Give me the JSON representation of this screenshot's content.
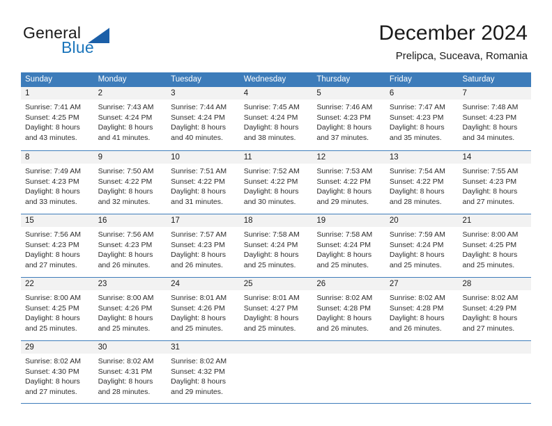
{
  "brand": {
    "name_part1": "General",
    "name_part2": "Blue"
  },
  "header": {
    "month_title": "December 2024",
    "location": "Prelipca, Suceava, Romania"
  },
  "colors": {
    "header_blue": "#3d7cba",
    "brand_blue": "#1b75bb",
    "day_band_gray": "#f2f2f2"
  },
  "weekdays": [
    "Sunday",
    "Monday",
    "Tuesday",
    "Wednesday",
    "Thursday",
    "Friday",
    "Saturday"
  ],
  "weeks": [
    [
      {
        "day": "1",
        "sunrise": "Sunrise: 7:41 AM",
        "sunset": "Sunset: 4:25 PM",
        "daylight1": "Daylight: 8 hours",
        "daylight2": "and 43 minutes."
      },
      {
        "day": "2",
        "sunrise": "Sunrise: 7:43 AM",
        "sunset": "Sunset: 4:24 PM",
        "daylight1": "Daylight: 8 hours",
        "daylight2": "and 41 minutes."
      },
      {
        "day": "3",
        "sunrise": "Sunrise: 7:44 AM",
        "sunset": "Sunset: 4:24 PM",
        "daylight1": "Daylight: 8 hours",
        "daylight2": "and 40 minutes."
      },
      {
        "day": "4",
        "sunrise": "Sunrise: 7:45 AM",
        "sunset": "Sunset: 4:24 PM",
        "daylight1": "Daylight: 8 hours",
        "daylight2": "and 38 minutes."
      },
      {
        "day": "5",
        "sunrise": "Sunrise: 7:46 AM",
        "sunset": "Sunset: 4:23 PM",
        "daylight1": "Daylight: 8 hours",
        "daylight2": "and 37 minutes."
      },
      {
        "day": "6",
        "sunrise": "Sunrise: 7:47 AM",
        "sunset": "Sunset: 4:23 PM",
        "daylight1": "Daylight: 8 hours",
        "daylight2": "and 35 minutes."
      },
      {
        "day": "7",
        "sunrise": "Sunrise: 7:48 AM",
        "sunset": "Sunset: 4:23 PM",
        "daylight1": "Daylight: 8 hours",
        "daylight2": "and 34 minutes."
      }
    ],
    [
      {
        "day": "8",
        "sunrise": "Sunrise: 7:49 AM",
        "sunset": "Sunset: 4:23 PM",
        "daylight1": "Daylight: 8 hours",
        "daylight2": "and 33 minutes."
      },
      {
        "day": "9",
        "sunrise": "Sunrise: 7:50 AM",
        "sunset": "Sunset: 4:22 PM",
        "daylight1": "Daylight: 8 hours",
        "daylight2": "and 32 minutes."
      },
      {
        "day": "10",
        "sunrise": "Sunrise: 7:51 AM",
        "sunset": "Sunset: 4:22 PM",
        "daylight1": "Daylight: 8 hours",
        "daylight2": "and 31 minutes."
      },
      {
        "day": "11",
        "sunrise": "Sunrise: 7:52 AM",
        "sunset": "Sunset: 4:22 PM",
        "daylight1": "Daylight: 8 hours",
        "daylight2": "and 30 minutes."
      },
      {
        "day": "12",
        "sunrise": "Sunrise: 7:53 AM",
        "sunset": "Sunset: 4:22 PM",
        "daylight1": "Daylight: 8 hours",
        "daylight2": "and 29 minutes."
      },
      {
        "day": "13",
        "sunrise": "Sunrise: 7:54 AM",
        "sunset": "Sunset: 4:22 PM",
        "daylight1": "Daylight: 8 hours",
        "daylight2": "and 28 minutes."
      },
      {
        "day": "14",
        "sunrise": "Sunrise: 7:55 AM",
        "sunset": "Sunset: 4:23 PM",
        "daylight1": "Daylight: 8 hours",
        "daylight2": "and 27 minutes."
      }
    ],
    [
      {
        "day": "15",
        "sunrise": "Sunrise: 7:56 AM",
        "sunset": "Sunset: 4:23 PM",
        "daylight1": "Daylight: 8 hours",
        "daylight2": "and 27 minutes."
      },
      {
        "day": "16",
        "sunrise": "Sunrise: 7:56 AM",
        "sunset": "Sunset: 4:23 PM",
        "daylight1": "Daylight: 8 hours",
        "daylight2": "and 26 minutes."
      },
      {
        "day": "17",
        "sunrise": "Sunrise: 7:57 AM",
        "sunset": "Sunset: 4:23 PM",
        "daylight1": "Daylight: 8 hours",
        "daylight2": "and 26 minutes."
      },
      {
        "day": "18",
        "sunrise": "Sunrise: 7:58 AM",
        "sunset": "Sunset: 4:24 PM",
        "daylight1": "Daylight: 8 hours",
        "daylight2": "and 25 minutes."
      },
      {
        "day": "19",
        "sunrise": "Sunrise: 7:58 AM",
        "sunset": "Sunset: 4:24 PM",
        "daylight1": "Daylight: 8 hours",
        "daylight2": "and 25 minutes."
      },
      {
        "day": "20",
        "sunrise": "Sunrise: 7:59 AM",
        "sunset": "Sunset: 4:24 PM",
        "daylight1": "Daylight: 8 hours",
        "daylight2": "and 25 minutes."
      },
      {
        "day": "21",
        "sunrise": "Sunrise: 8:00 AM",
        "sunset": "Sunset: 4:25 PM",
        "daylight1": "Daylight: 8 hours",
        "daylight2": "and 25 minutes."
      }
    ],
    [
      {
        "day": "22",
        "sunrise": "Sunrise: 8:00 AM",
        "sunset": "Sunset: 4:25 PM",
        "daylight1": "Daylight: 8 hours",
        "daylight2": "and 25 minutes."
      },
      {
        "day": "23",
        "sunrise": "Sunrise: 8:00 AM",
        "sunset": "Sunset: 4:26 PM",
        "daylight1": "Daylight: 8 hours",
        "daylight2": "and 25 minutes."
      },
      {
        "day": "24",
        "sunrise": "Sunrise: 8:01 AM",
        "sunset": "Sunset: 4:26 PM",
        "daylight1": "Daylight: 8 hours",
        "daylight2": "and 25 minutes."
      },
      {
        "day": "25",
        "sunrise": "Sunrise: 8:01 AM",
        "sunset": "Sunset: 4:27 PM",
        "daylight1": "Daylight: 8 hours",
        "daylight2": "and 25 minutes."
      },
      {
        "day": "26",
        "sunrise": "Sunrise: 8:02 AM",
        "sunset": "Sunset: 4:28 PM",
        "daylight1": "Daylight: 8 hours",
        "daylight2": "and 26 minutes."
      },
      {
        "day": "27",
        "sunrise": "Sunrise: 8:02 AM",
        "sunset": "Sunset: 4:28 PM",
        "daylight1": "Daylight: 8 hours",
        "daylight2": "and 26 minutes."
      },
      {
        "day": "28",
        "sunrise": "Sunrise: 8:02 AM",
        "sunset": "Sunset: 4:29 PM",
        "daylight1": "Daylight: 8 hours",
        "daylight2": "and 27 minutes."
      }
    ],
    [
      {
        "day": "29",
        "sunrise": "Sunrise: 8:02 AM",
        "sunset": "Sunset: 4:30 PM",
        "daylight1": "Daylight: 8 hours",
        "daylight2": "and 27 minutes."
      },
      {
        "day": "30",
        "sunrise": "Sunrise: 8:02 AM",
        "sunset": "Sunset: 4:31 PM",
        "daylight1": "Daylight: 8 hours",
        "daylight2": "and 28 minutes."
      },
      {
        "day": "31",
        "sunrise": "Sunrise: 8:02 AM",
        "sunset": "Sunset: 4:32 PM",
        "daylight1": "Daylight: 8 hours",
        "daylight2": "and 29 minutes."
      },
      {
        "day": "",
        "sunrise": "",
        "sunset": "",
        "daylight1": "",
        "daylight2": ""
      },
      {
        "day": "",
        "sunrise": "",
        "sunset": "",
        "daylight1": "",
        "daylight2": ""
      },
      {
        "day": "",
        "sunrise": "",
        "sunset": "",
        "daylight1": "",
        "daylight2": ""
      },
      {
        "day": "",
        "sunrise": "",
        "sunset": "",
        "daylight1": "",
        "daylight2": ""
      }
    ]
  ]
}
